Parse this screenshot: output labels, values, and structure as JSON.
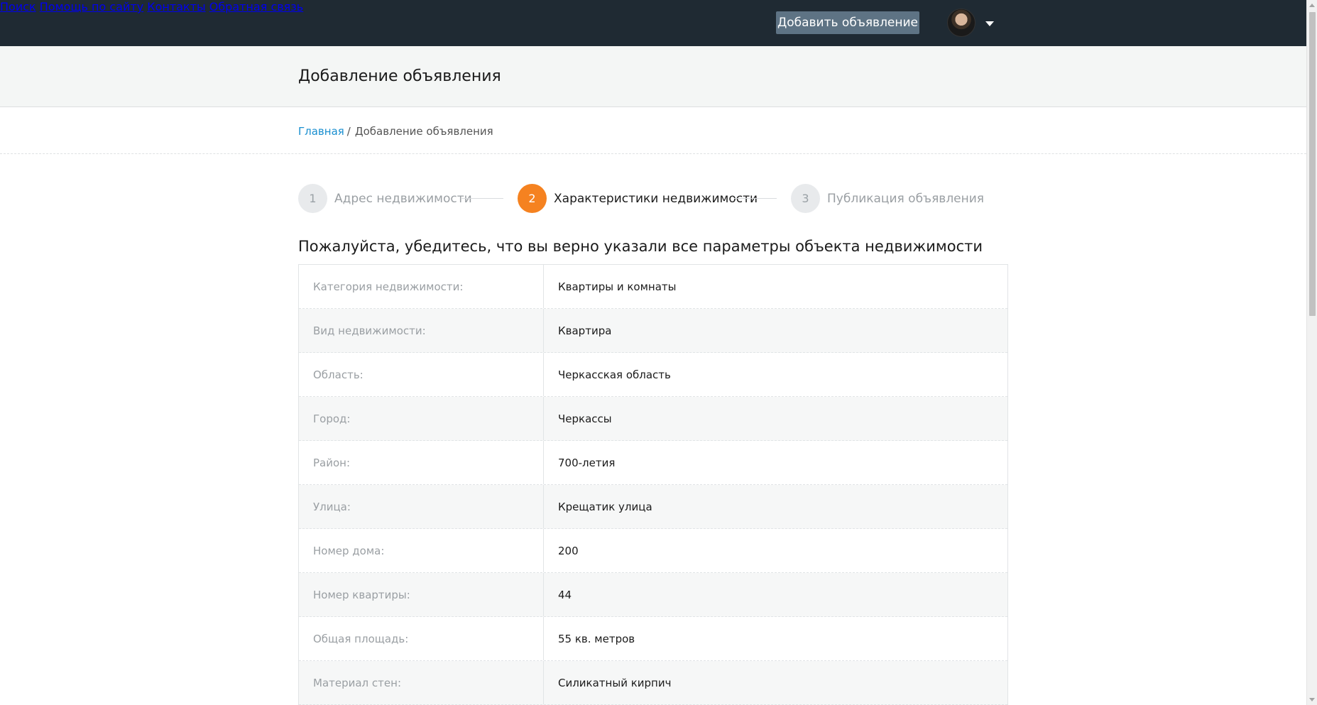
{
  "header": {
    "nav": [
      {
        "label": "Поиск"
      },
      {
        "label": "Помощь по сайту"
      },
      {
        "label": "Контакты"
      },
      {
        "label": "Обратная связь"
      }
    ],
    "add_button_label": "Добавить объявление",
    "user_menu_icon": "chevron-down-icon"
  },
  "page": {
    "title": "Добавление объявления"
  },
  "breadcrumb": {
    "home": "Главная",
    "separator": "/",
    "current": "Добавление объявления"
  },
  "steps": [
    {
      "number": "1",
      "label": "Адрес недвижимости",
      "state": "done"
    },
    {
      "number": "2",
      "label": "Характеристики недвижимости",
      "state": "active"
    },
    {
      "number": "3",
      "label": "Публикация объявления",
      "state": "pending"
    }
  ],
  "section": {
    "heading": "Пожалуйста, убедитесь, что вы верно указали все параметры объекта недвижимости"
  },
  "params": [
    {
      "label": "Категория недвижимости:",
      "value": "Квартиры и комнаты"
    },
    {
      "label": "Вид недвижимости:",
      "value": "Квартира"
    },
    {
      "label": "Область:",
      "value": "Черкасская область"
    },
    {
      "label": "Город:",
      "value": "Черкассы"
    },
    {
      "label": "Район:",
      "value": "700-летия"
    },
    {
      "label": "Улица:",
      "value": "Крещатик улица"
    },
    {
      "label": "Номер дома:",
      "value": "200"
    },
    {
      "label": "Номер квартиры:",
      "value": "44"
    },
    {
      "label": "Общая площадь:",
      "value": "55 кв. метров"
    },
    {
      "label": "Материал стен:",
      "value": "Силикатный кирпич"
    }
  ],
  "colors": {
    "topbar": "#1f2a33",
    "accent_step": "#f58220",
    "link": "#1a8fd0",
    "button": "#5e7384"
  }
}
